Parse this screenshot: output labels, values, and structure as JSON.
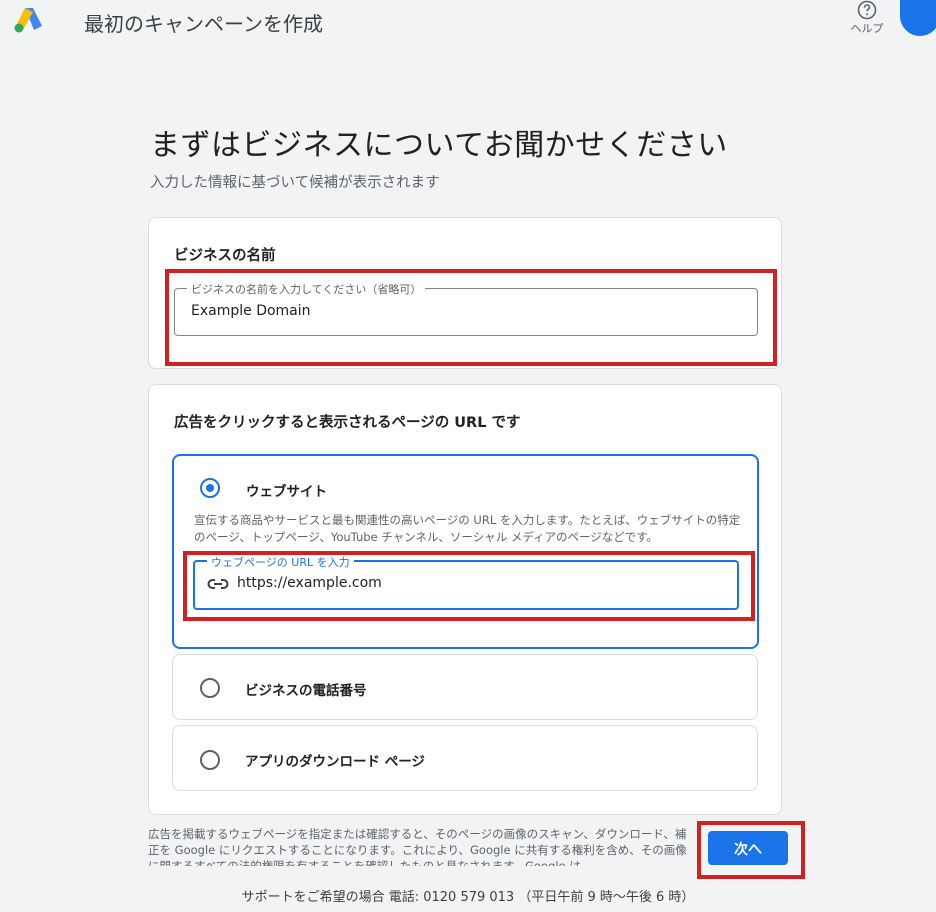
{
  "header": {
    "title": "最初のキャンペーンを作成",
    "help_label": "ヘルプ",
    "logo_icon": "google-ads-logo",
    "help_icon": "help-circle-icon"
  },
  "main": {
    "title": "まずはビジネスについてお聞かせください",
    "subtitle": "入力した情報に基づいて候補が表示されます"
  },
  "business_name": {
    "card_title": "ビジネスの名前",
    "field_label": "ビジネスの名前を入力してください（省略可）",
    "field_value": "Example Domain"
  },
  "url_section": {
    "card_title": "広告をクリックすると表示されるページの URL です",
    "options": [
      {
        "label": "ウェブサイト",
        "selected": true,
        "description": "宣伝する商品やサービスと最も関連性の高いページの URL を入力します。たとえば、ウェブサイトの特定のページ、トップページ、YouTube チャンネル、ソーシャル メディアのページなどです。",
        "field_label": "ウェブページの URL を入力",
        "field_value": "https://example.com",
        "field_icon": "link-icon"
      },
      {
        "label": "ビジネスの電話番号",
        "selected": false
      },
      {
        "label": "アプリのダウンロード ページ",
        "selected": false
      }
    ]
  },
  "footer": {
    "disclaimer": "広告を掲載するウェブページを指定または確認すると、そのページの画像のスキャン、ダウンロード、補正を Google にリクエストすることになります。これにより、Google に共有する権利を含め、その画像に関するすべての法的権限を有することを確認したものと見なされます。Google は",
    "next_button": "次へ",
    "support": "サポートをご希望の場合 電話: 0120 579 013 （平日午前 9 時〜午後 6 時）"
  },
  "colors": {
    "accent": "#1a73e8",
    "annotation_red": "#d32020",
    "background": "#f1f3f4"
  }
}
